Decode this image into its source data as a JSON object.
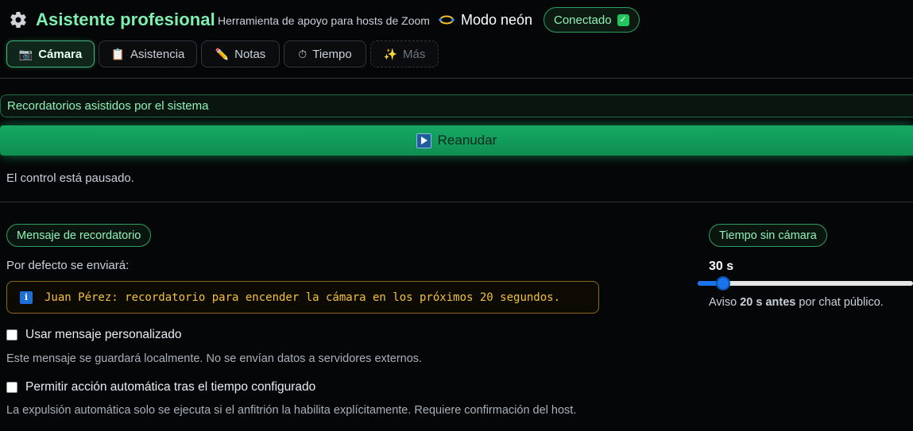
{
  "header": {
    "title": "Asistente profesional",
    "subtitle": "Herramienta de apoyo para hosts de Zoom",
    "neon_mode_label": "Modo neón",
    "status_badge": "Conectado"
  },
  "tabs": [
    {
      "icon": "camera-icon",
      "label": "Cámara",
      "active": true
    },
    {
      "icon": "clipboard-icon",
      "label": "Asistencia",
      "active": false
    },
    {
      "icon": "pencil-icon",
      "label": "Notas",
      "active": false
    },
    {
      "icon": "stopwatch-icon",
      "label": "Tiempo",
      "active": false
    },
    {
      "icon": "sparkles-icon",
      "label": "Más",
      "active": false,
      "disabled": true
    }
  ],
  "reminders": {
    "section_title": "Recordatorios asistidos por el sistema",
    "resume_button": "Reanudar",
    "paused_status": "El control está pausado."
  },
  "message": {
    "pill": "Mensaje de recordatorio",
    "default_label": "Por defecto se enviará:",
    "preview": "Juan Pérez: recordatorio para encender la cámara en los próximos 20 segundos.",
    "custom_checkbox_label": "Usar mensaje personalizado",
    "custom_checkbox_checked": false,
    "custom_help": "Este mensaje se guardará localmente. No se envían datos a servidores externos.",
    "auto_checkbox_label": "Permitir acción automática tras el tiempo configurado",
    "auto_checkbox_checked": false,
    "auto_help": "La expulsión automática solo se ejecuta si el anfitrión la habilita explícitamente. Requiere confirmación del host."
  },
  "timer": {
    "pill": "Tiempo sin cámara",
    "value_label": "30 s",
    "slider_fraction": 0.09,
    "note_prefix": "Aviso",
    "note_bold": "20 s antes",
    "note_suffix": "por chat público."
  },
  "colors": {
    "accent": "#7ef0b0",
    "button_green": "#16a864",
    "warning_border": "#8a6a1e",
    "slider_blue": "#1a73e8"
  }
}
